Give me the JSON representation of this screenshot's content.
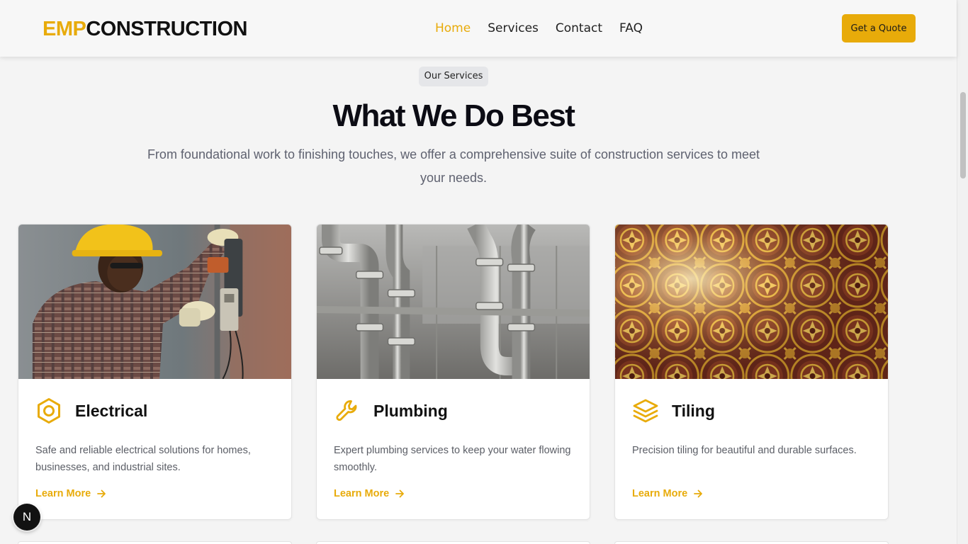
{
  "header": {
    "logo_accent": "EMP",
    "logo_rest": "CONSTRUCTION",
    "nav": [
      {
        "label": "Home",
        "active": true
      },
      {
        "label": "Services",
        "active": false
      },
      {
        "label": "Contact",
        "active": false
      },
      {
        "label": "FAQ",
        "active": false
      }
    ],
    "cta_label": "Get a Quote"
  },
  "section": {
    "badge": "Our Services",
    "title": "What We Do Best",
    "subtitle": "From foundational work to finishing touches, we offer a comprehensive suite of construction services to meet your needs."
  },
  "cards": [
    {
      "title": "Electrical",
      "icon": "hexagon-nut-icon",
      "description": "Safe and reliable electrical solutions for homes, businesses, and industrial sites.",
      "link": "Learn More"
    },
    {
      "title": "Plumbing",
      "icon": "wrench-icon",
      "description": "Expert plumbing services to keep your water flowing smoothly.",
      "link": "Learn More"
    },
    {
      "title": "Tiling",
      "icon": "layers-icon",
      "description": "Precision tiling for beautiful and durable surfaces.",
      "link": "Learn More"
    }
  ],
  "fab_label": "N",
  "colors": {
    "accent": "#e8ab0a",
    "heading": "#0c0c14",
    "muted_text": "#5f6270",
    "page_bg": "#f4f4f4"
  }
}
